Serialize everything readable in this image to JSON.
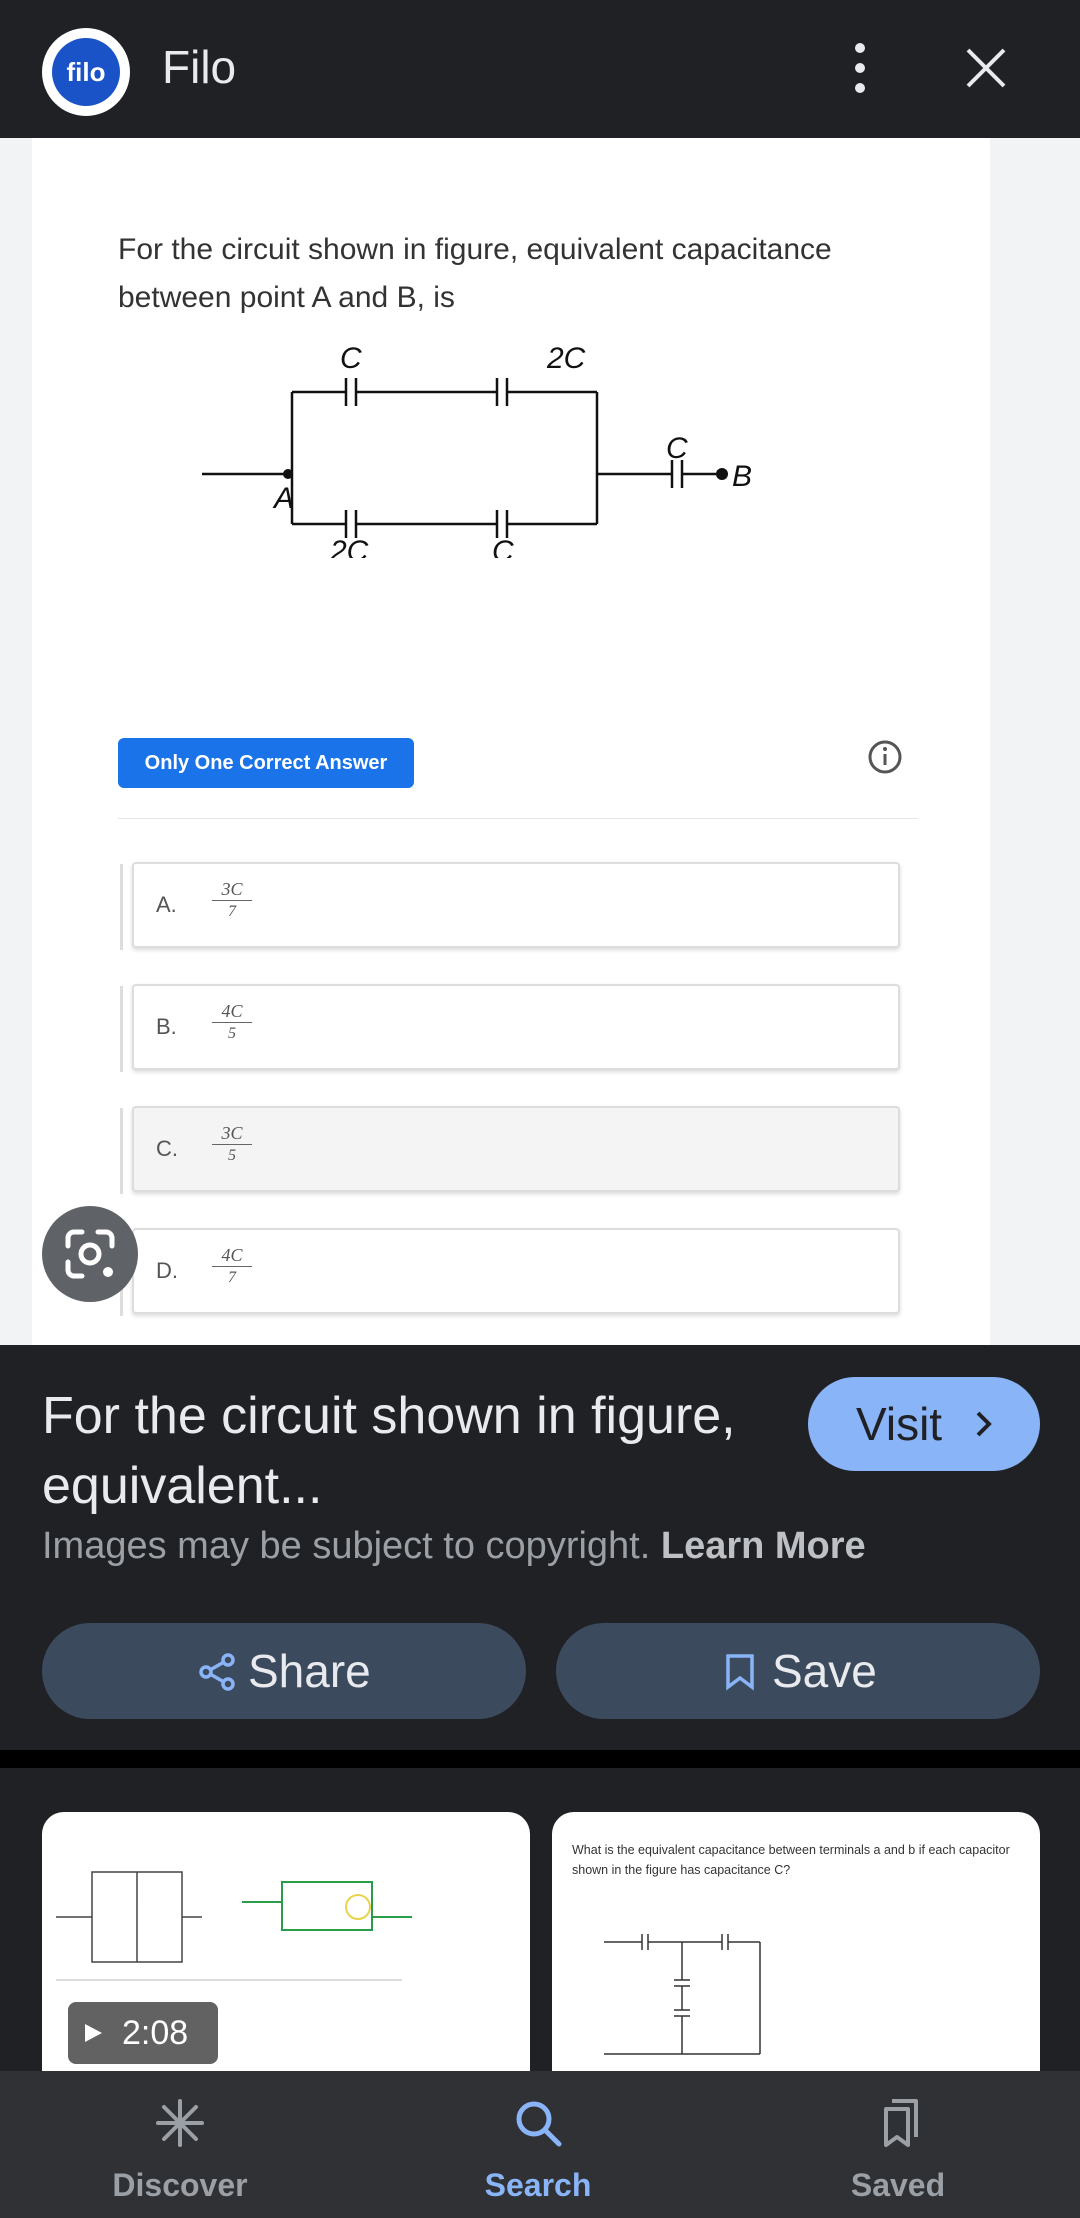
{
  "header": {
    "logo_text": "filo",
    "app_title": "Filo",
    "more_icon": "more-vert-icon",
    "close_icon": "close-icon"
  },
  "preview": {
    "question": "For the circuit shown in figure, equivalent capacitance between point A and B, is",
    "circuit_labels": {
      "top_left": "C",
      "top_right": "2C",
      "right": "C",
      "bottom_left": "2C",
      "bottom_right": "C",
      "point_a": "A",
      "point_b": "B"
    },
    "badge": "Only One Correct Answer",
    "options": [
      {
        "letter": "A.",
        "num": "3C",
        "den": "7"
      },
      {
        "letter": "B.",
        "num": "4C",
        "den": "5"
      },
      {
        "letter": "C.",
        "num": "3C",
        "den": "5"
      },
      {
        "letter": "D.",
        "num": "4C",
        "den": "7"
      }
    ]
  },
  "info": {
    "title": "For the circuit shown in figure, equivalent...",
    "visit_label": "Visit",
    "copyright_text": "Images may be subject to copyright.",
    "learn_more": "Learn More",
    "share_label": "Share",
    "save_label": "Save"
  },
  "results": [
    {
      "duration": "2:08",
      "type": "video"
    },
    {
      "caption": "What is the equivalent capacitance between terminals a and b if each capacitor shown in the figure has capacitance C?"
    }
  ],
  "bottom_nav": [
    {
      "label": "Discover",
      "icon": "asterisk-icon",
      "active": false
    },
    {
      "label": "Search",
      "icon": "search-icon",
      "active": true
    },
    {
      "label": "Saved",
      "icon": "bookmarks-icon",
      "active": false
    }
  ],
  "colors": {
    "background": "#202124",
    "accent": "#8ab4f8",
    "badge": "#1a73e8",
    "button": "#3c4a5e"
  }
}
